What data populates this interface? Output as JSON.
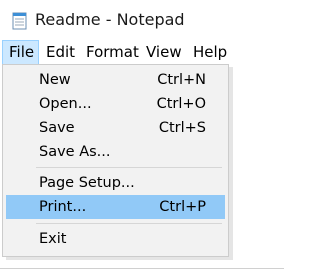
{
  "window": {
    "title": "Readme - Notepad",
    "icon": "notepad-icon"
  },
  "menubar": {
    "items": [
      {
        "label": "File",
        "active": true
      },
      {
        "label": "Edit"
      },
      {
        "label": "Format"
      },
      {
        "label": "View"
      },
      {
        "label": "Help"
      }
    ]
  },
  "file_menu": {
    "items": [
      {
        "label": "New",
        "shortcut": "Ctrl+N"
      },
      {
        "label": "Open...",
        "shortcut": "Ctrl+O"
      },
      {
        "label": "Save",
        "shortcut": "Ctrl+S"
      },
      {
        "label": "Save As...",
        "shortcut": ""
      },
      {
        "label": "Page Setup...",
        "shortcut": ""
      },
      {
        "label": "Print...",
        "shortcut": "Ctrl+P",
        "highlighted": true
      },
      {
        "label": "Exit",
        "shortcut": ""
      }
    ]
  },
  "colors": {
    "highlight": "#91c9f7",
    "menubar_active": "#cce8ff",
    "dropdown_bg": "#f2f2f2"
  }
}
